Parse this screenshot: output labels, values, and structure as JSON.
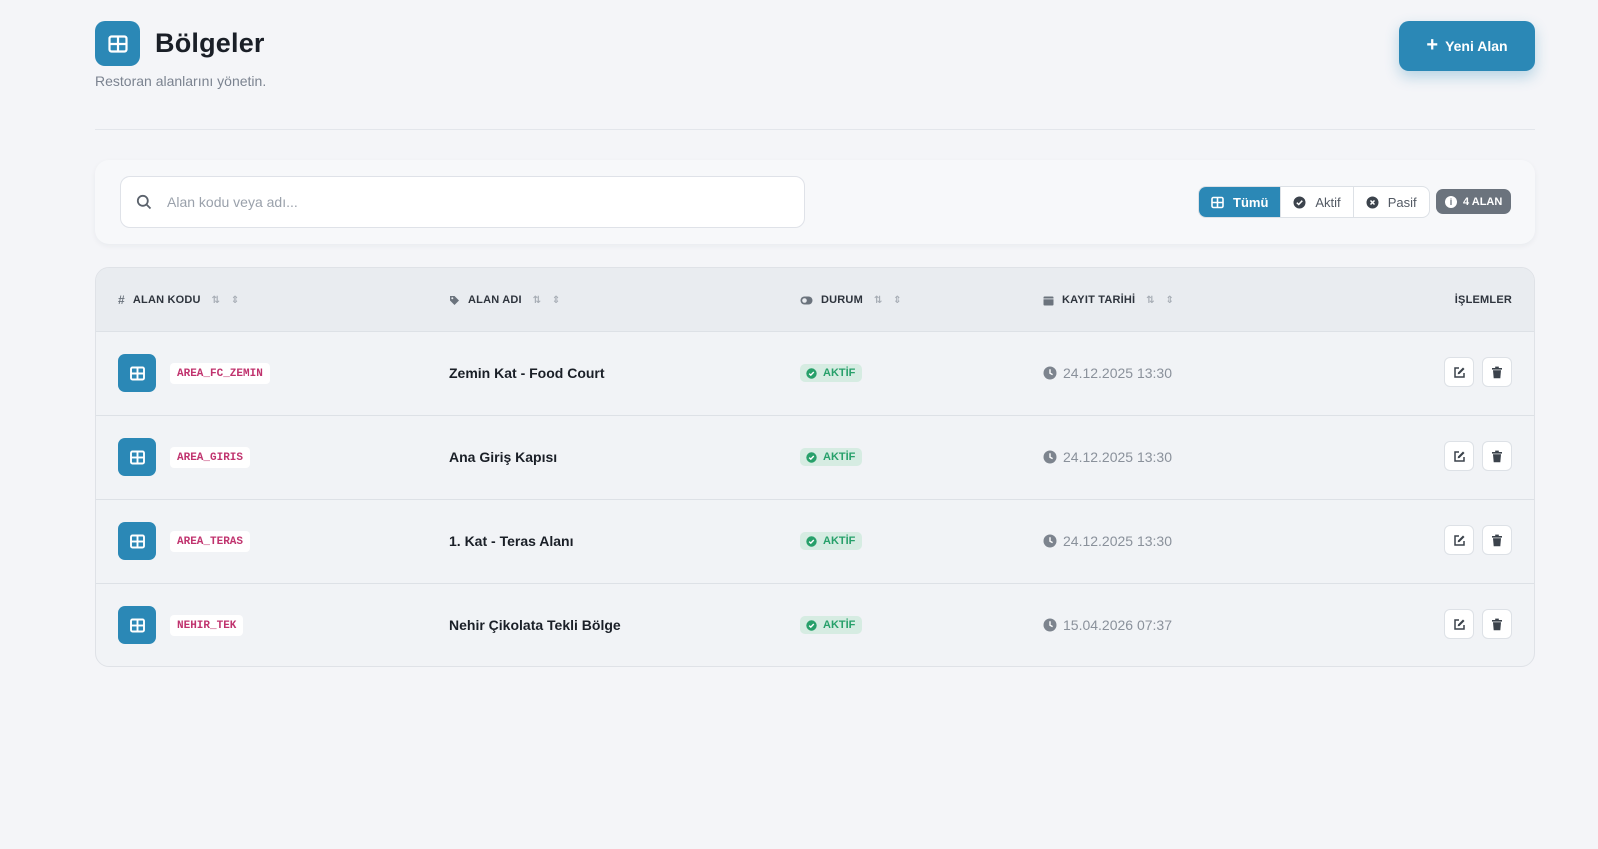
{
  "header": {
    "title": "Bölgeler",
    "subtitle": "Restoran alanlarını yönetin.",
    "title_icon": "grid-icon",
    "new_button_label": "Yeni Alan"
  },
  "search": {
    "placeholder": "Alan kodu veya adı...",
    "value": ""
  },
  "filters": {
    "items": [
      {
        "label": "Tümü",
        "icon": "grid-icon",
        "active": true
      },
      {
        "label": "Aktif",
        "icon": "check-circle-icon",
        "active": false
      },
      {
        "label": "Pasif",
        "icon": "x-circle-icon",
        "active": false
      }
    ],
    "count_label": "4 ALAN"
  },
  "table": {
    "columns": [
      {
        "label": "ALAN KODU",
        "icon": "hash-icon"
      },
      {
        "label": "ALAN ADI",
        "icon": "tag-icon"
      },
      {
        "label": "DURUM",
        "icon": "toggle-icon"
      },
      {
        "label": "KAYIT TARİHİ",
        "icon": "calendar-icon"
      },
      {
        "label": "İŞLEMLER",
        "icon": ""
      }
    ],
    "rows": [
      {
        "code": "AREA_FC_ZEMIN",
        "name": "Zemin Kat - Food Court",
        "status": "AKTİF",
        "date": "24.12.2025 13:30"
      },
      {
        "code": "AREA_GIRIS",
        "name": "Ana Giriş Kapısı",
        "status": "AKTİF",
        "date": "24.12.2025 13:30"
      },
      {
        "code": "AREA_TERAS",
        "name": "1. Kat - Teras Alanı",
        "status": "AKTİF",
        "date": "24.12.2025 13:30"
      },
      {
        "code": "NEHIR_TEK",
        "name": "Nehir Çikolata Tekli Bölge",
        "status": "AKTİF",
        "date": "15.04.2026 07:37"
      }
    ]
  },
  "colors": {
    "primary": "#2b88b6",
    "code_text": "#c0336e",
    "status_green": "#27a06a",
    "status_bg": "#d6ece2"
  }
}
